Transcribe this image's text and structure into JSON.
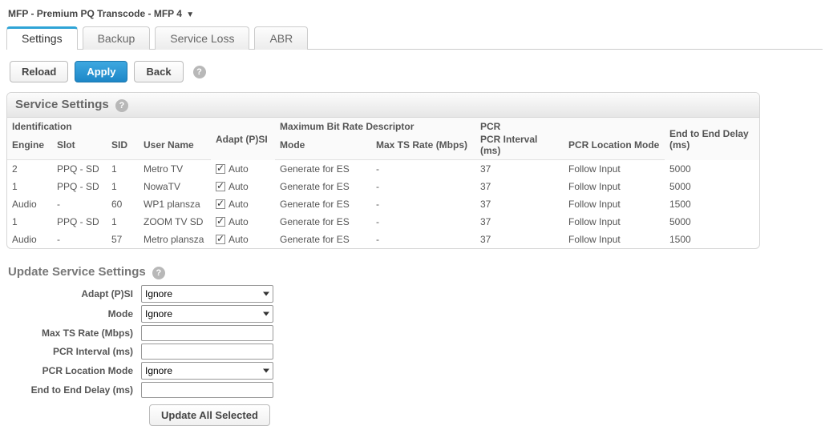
{
  "breadcrumb": {
    "text": "MFP - Premium PQ Transcode - MFP 4"
  },
  "tabs": [
    {
      "label": "Settings",
      "active": true
    },
    {
      "label": "Backup",
      "active": false
    },
    {
      "label": "Service Loss",
      "active": false
    },
    {
      "label": "ABR",
      "active": false
    }
  ],
  "toolbar": {
    "reload": "Reload",
    "apply": "Apply",
    "back": "Back"
  },
  "panel": {
    "title": "Service Settings",
    "groupHeaders": {
      "identification": "Identification",
      "adapt_psi": "Adapt (P)SI",
      "max_br_desc": "Maximum Bit Rate Descriptor",
      "pcr": "PCR",
      "e2e_delay": "End to End Delay (ms)"
    },
    "subHeaders": {
      "engine": "Engine",
      "slot": "Slot",
      "sid": "SID",
      "user_name": "User Name",
      "mode": "Mode",
      "max_ts_rate": "Max TS Rate (Mbps)",
      "pcr_interval": "PCR Interval (ms)",
      "pcr_loc_mode": "PCR Location Mode"
    },
    "autoLabel": "Auto",
    "rows": [
      {
        "engine": "2",
        "slot": "PPQ - SD",
        "sid": "1",
        "user_name": "Metro TV",
        "adapt_psi": true,
        "mode": "Generate for ES",
        "max_ts_rate": "-",
        "pcr_interval": "37",
        "pcr_loc_mode": "Follow Input",
        "e2e_delay": "5000"
      },
      {
        "engine": "1",
        "slot": "PPQ - SD",
        "sid": "1",
        "user_name": "NowaTV",
        "adapt_psi": true,
        "mode": "Generate for ES",
        "max_ts_rate": "-",
        "pcr_interval": "37",
        "pcr_loc_mode": "Follow Input",
        "e2e_delay": "5000"
      },
      {
        "engine": "Audio",
        "slot": "-",
        "sid": "60",
        "user_name": "WP1 plansza",
        "adapt_psi": true,
        "mode": "Generate for ES",
        "max_ts_rate": "-",
        "pcr_interval": "37",
        "pcr_loc_mode": "Follow Input",
        "e2e_delay": "1500"
      },
      {
        "engine": "1",
        "slot": "PPQ - SD",
        "sid": "1",
        "user_name": "ZOOM TV SD",
        "adapt_psi": true,
        "mode": "Generate for ES",
        "max_ts_rate": "-",
        "pcr_interval": "37",
        "pcr_loc_mode": "Follow Input",
        "e2e_delay": "5000"
      },
      {
        "engine": "Audio",
        "slot": "-",
        "sid": "57",
        "user_name": "Metro plansza",
        "adapt_psi": true,
        "mode": "Generate for ES",
        "max_ts_rate": "-",
        "pcr_interval": "37",
        "pcr_loc_mode": "Follow Input",
        "e2e_delay": "1500"
      }
    ]
  },
  "update": {
    "title": "Update Service Settings",
    "labels": {
      "adapt_psi": "Adapt (P)SI",
      "mode": "Mode",
      "max_ts_rate": "Max TS Rate (Mbps)",
      "pcr_interval": "PCR Interval (ms)",
      "pcr_loc_mode": "PCR Location Mode",
      "e2e_delay": "End to End Delay (ms)"
    },
    "values": {
      "adapt_psi": "Ignore",
      "mode": "Ignore",
      "max_ts_rate": "",
      "pcr_interval": "",
      "pcr_loc_mode": "Ignore",
      "e2e_delay": ""
    },
    "button": "Update All Selected"
  }
}
